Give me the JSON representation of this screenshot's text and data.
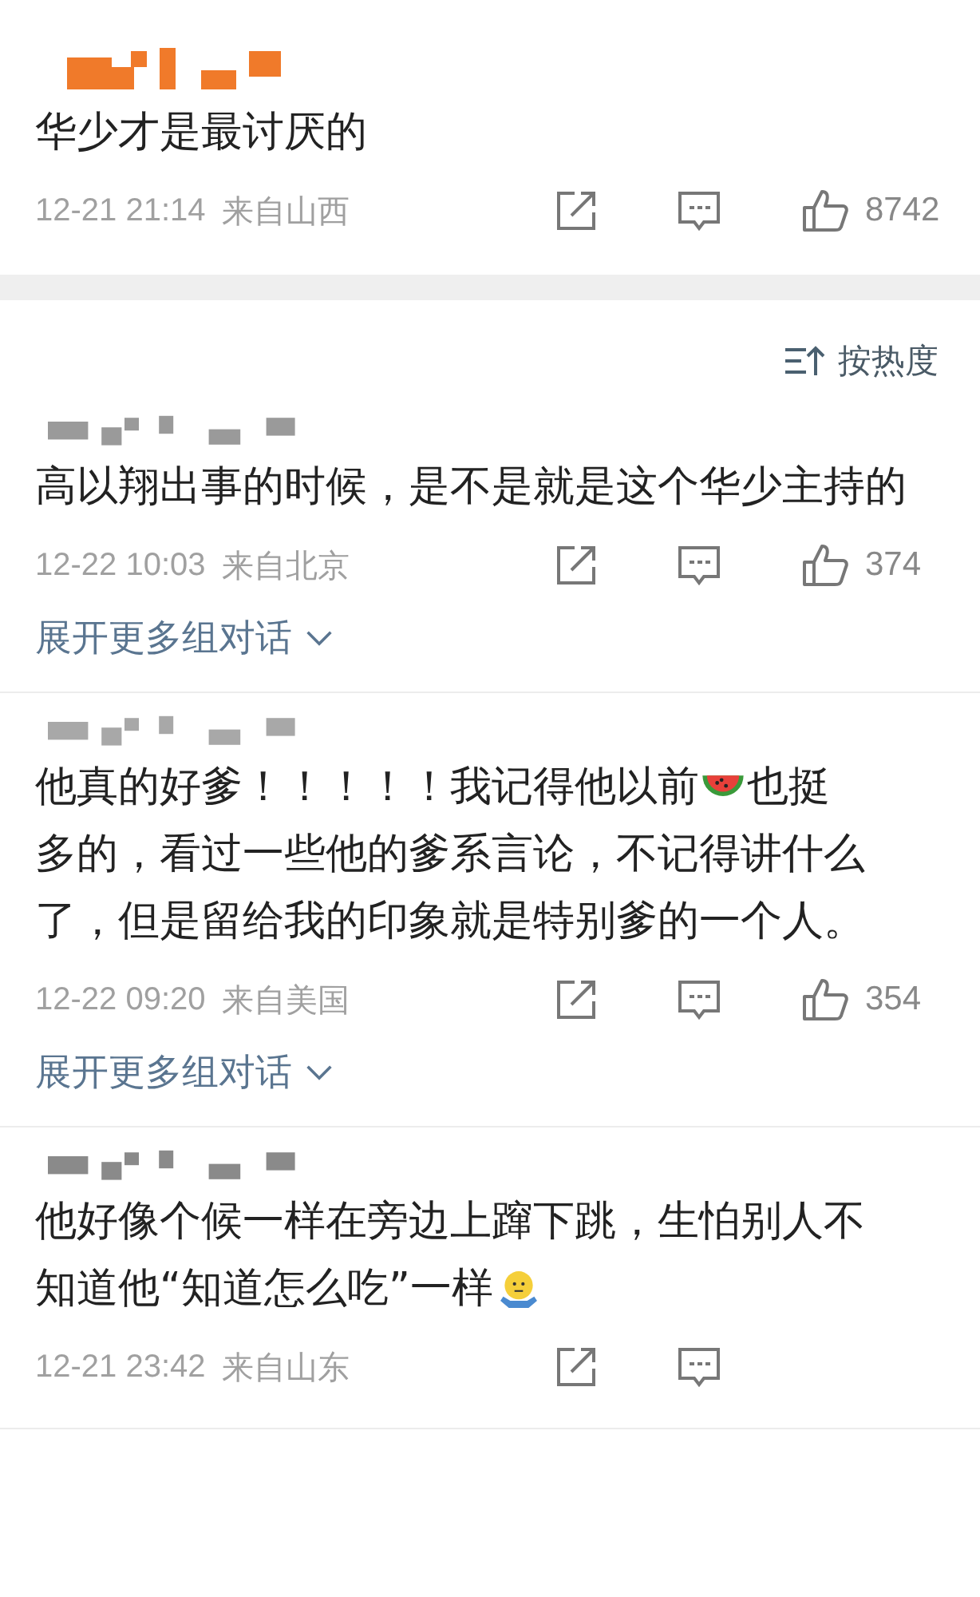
{
  "top_comment": {
    "author": {
      "kind": "redacted",
      "color": "#f07a2a"
    },
    "parts": [
      {
        "kind": "text",
        "text": "华少才是最讨厌的"
      }
    ],
    "time": "12-21 21:14",
    "location": "来自山西",
    "likes": "8742"
  },
  "sort": {
    "label": "按热度"
  },
  "comments": [
    {
      "author": {
        "kind": "redacted",
        "color": "#9a9a9a"
      },
      "lines": [
        [
          {
            "kind": "text",
            "text": "高以翔出事的时候，是不是就是这个华少主持的"
          }
        ]
      ],
      "time": "12-22 10:03",
      "location": "来自北京",
      "likes": "374",
      "expand": "展开更多组对话"
    },
    {
      "author": {
        "kind": "redacted",
        "color": "#a8a8a8"
      },
      "lines": [
        [
          {
            "kind": "text",
            "text": "他真的好爹！！！！！我记得他以前"
          },
          {
            "kind": "watermelon"
          },
          {
            "kind": "text",
            "text": "也挺"
          }
        ],
        [
          {
            "kind": "text",
            "text": "多的，看过一些他的爹系言论，不记得讲什么"
          }
        ],
        [
          {
            "kind": "text",
            "text": "了，但是留给我的印象就是特别爹的一个人。"
          }
        ]
      ],
      "time": "12-22 09:20",
      "location": "来自美国",
      "likes": "354",
      "expand": "展开更多组对话"
    },
    {
      "author": {
        "kind": "redacted",
        "color": "#8a8a8a"
      },
      "lines": [
        [
          {
            "kind": "text",
            "text": "他好像个候一样在旁边上蹿下跳，生怕别人不"
          }
        ],
        [
          {
            "kind": "text",
            "text": "知道他“知道怎么吃”一样"
          },
          {
            "kind": "shrug"
          }
        ]
      ],
      "time": "12-21 23:42",
      "location": "来自山东"
    }
  ]
}
